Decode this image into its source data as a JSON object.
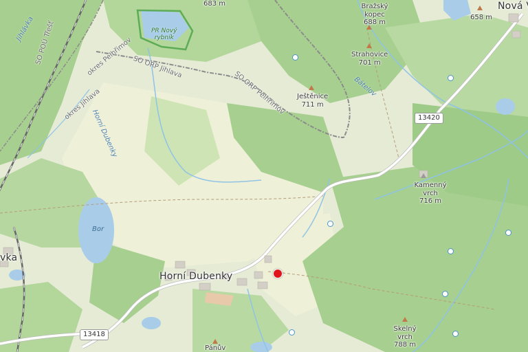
{
  "map": {
    "town_label": "Horní Dubenky",
    "partial_labels": {
      "nova": "Nová V",
      "vka": "vka",
      "jihlavka": "Jihlávka",
      "trest": "SO POÚ Třešť"
    },
    "reserve": {
      "line1": "PR Nový",
      "line2": "rybník"
    },
    "lake_label": "Bor",
    "stream_label": "Bátelov",
    "boundaries": {
      "district": "okres Pelhřimov",
      "district2": "okres Jihlava",
      "orp_jihlava": "SO ORP Jihlava",
      "orp_pelhrimov": "SO ORP Pelhřimov"
    },
    "stream_horni_dubenky": "Horní Dubenky",
    "peaks": [
      {
        "name": "",
        "elev": "683 m"
      },
      {
        "name": "Bražský kopec",
        "elev": "688 m"
      },
      {
        "name": "",
        "elev": "658 m"
      },
      {
        "name": "Strahovice",
        "elev": "701 m"
      },
      {
        "name": "Ještěnice",
        "elev": "711 m"
      },
      {
        "name": "Kamenný vrch",
        "elev": "716 m"
      },
      {
        "name": "Skelný vrch",
        "elev": "788 m"
      },
      {
        "name": "Pánův",
        "elev": ""
      }
    ],
    "road_shields": [
      "13420",
      "13418"
    ],
    "colors": {
      "forest": "#a7cf8f",
      "meadow": "#e6ebd6",
      "field": "#f0f0d9",
      "water": "#a9cde8",
      "road": "#ffffff",
      "boundary": "#8b8b8b",
      "marker": "#e0141b"
    },
    "marker_label": "location-marker"
  }
}
